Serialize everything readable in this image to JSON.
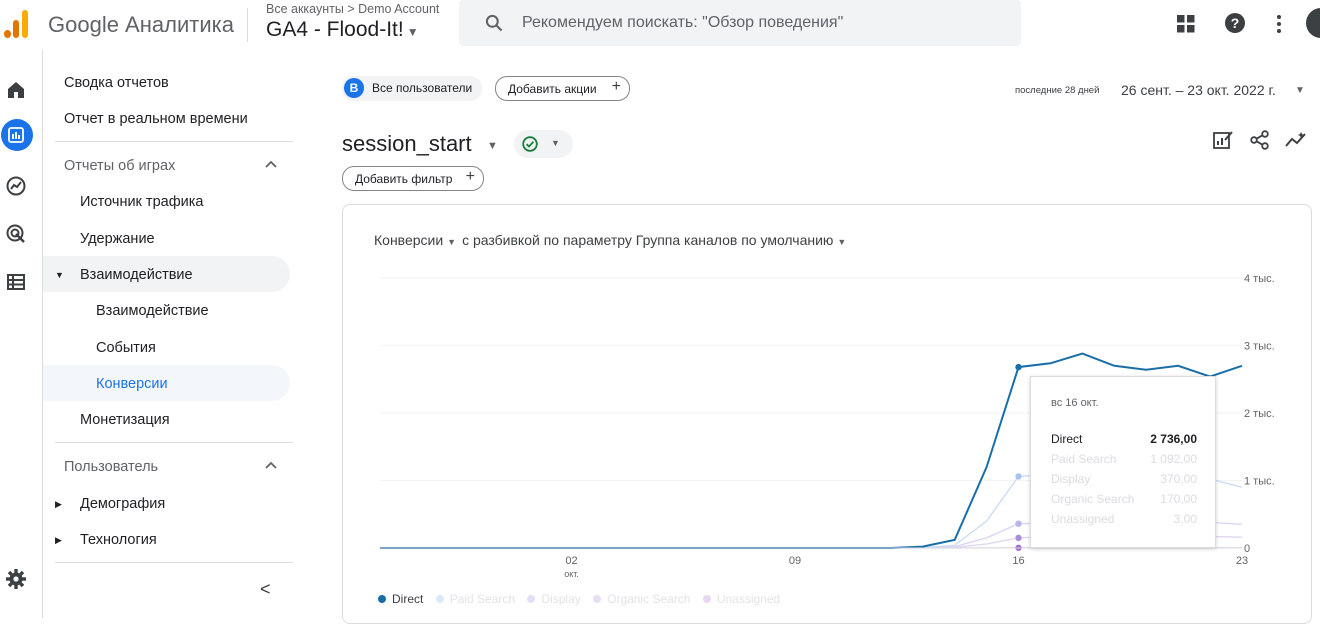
{
  "header": {
    "brand": "Google Аналитика",
    "breadcrumb": "Все аккаунты > Demo Account",
    "property": "GA4 - Flood-It!",
    "search_placeholder": "Рекомендуем поискать: \"Обзор поведения\"",
    "icons": [
      "apps-grid-icon",
      "help-icon",
      "more-vert-icon",
      "avatar"
    ]
  },
  "rail": {
    "icons": [
      "home-icon",
      "reports-icon",
      "explore-icon",
      "advertising-icon",
      "configure-icon",
      "settings-icon"
    ]
  },
  "nav": {
    "summary": "Сводка отчетов",
    "realtime": "Отчет в реальном времени",
    "games_section": "Отчеты об играх",
    "traffic": "Источник трафика",
    "retention": "Удержание",
    "engagement": "Взаимодействие",
    "engagement_overview": "Взаимодействие",
    "events": "События",
    "conversions": "Конверсии",
    "monetization": "Монетизация",
    "user_section": "Пользователь",
    "demographics": "Демография",
    "tech": "Технология",
    "collapse": "<"
  },
  "toolbar": {
    "segment_badge": "B",
    "segment_label": "Все пользователи",
    "add_comparison": "Добавить акции",
    "date_small": "последние 28 дней",
    "date_range": "26 сент. – 23 окт. 2022 г."
  },
  "report": {
    "title": "session_start",
    "add_filter": "Добавить фильтр"
  },
  "card": {
    "metric": "Конверсии",
    "breakdown": "с разбивкой по параметру Группа каналов по умолчанию"
  },
  "tooltip": {
    "date": "вс 16 окт.",
    "rows": [
      {
        "label": "Direct",
        "value": "2 736,00"
      },
      {
        "label": "Paid Search",
        "value": "1 092,00"
      },
      {
        "label": "Display",
        "value": "370,00"
      },
      {
        "label": "Organic Search",
        "value": "170,00"
      },
      {
        "label": "Unassigned",
        "value": "3,00"
      }
    ]
  },
  "colors": {
    "accent": "#1a73e8",
    "direct": "#1a6ea8",
    "paid_search": "#c9dcf3",
    "display": "#d6d4f4",
    "organic_search": "#e0d4f0",
    "unassigned": "#e0cff0"
  },
  "chart_data": {
    "type": "line",
    "x": [
      "26",
      "27",
      "28",
      "29",
      "30",
      "01",
      "02",
      "03",
      "04",
      "05",
      "06",
      "07",
      "08",
      "09",
      "10",
      "11",
      "12",
      "13",
      "14",
      "15",
      "16",
      "17",
      "18",
      "19",
      "20",
      "21",
      "22",
      "23"
    ],
    "x_ticks": [
      {
        "value": "02",
        "sub": "окт."
      },
      {
        "value": "09",
        "sub": ""
      },
      {
        "value": "16",
        "sub": ""
      },
      {
        "value": "23",
        "sub": ""
      }
    ],
    "y_ticks": [
      "0",
      "1 тыс.",
      "2 тыс.",
      "3 тыс.",
      "4 тыс."
    ],
    "ylim": [
      0,
      4000
    ],
    "legend": "bottom",
    "series": [
      {
        "name": "Direct",
        "values": [
          0,
          0,
          0,
          0,
          0,
          0,
          0,
          0,
          0,
          0,
          0,
          0,
          0,
          0,
          0,
          0,
          0,
          20,
          120,
          1200,
          2680,
          2736,
          2880,
          2700,
          2640,
          2700,
          2540,
          2700
        ]
      },
      {
        "name": "Paid Search",
        "values": [
          0,
          0,
          0,
          0,
          0,
          0,
          0,
          0,
          0,
          0,
          0,
          0,
          0,
          0,
          0,
          0,
          0,
          5,
          40,
          400,
          1060,
          1092,
          1180,
          1080,
          1050,
          1100,
          1020,
          900
        ]
      },
      {
        "name": "Display",
        "values": [
          0,
          0,
          0,
          0,
          0,
          0,
          0,
          0,
          0,
          0,
          0,
          0,
          0,
          0,
          0,
          0,
          0,
          2,
          20,
          150,
          360,
          370,
          430,
          380,
          360,
          400,
          380,
          350
        ]
      },
      {
        "name": "Organic Search",
        "values": [
          0,
          0,
          0,
          0,
          0,
          0,
          0,
          0,
          0,
          0,
          0,
          0,
          0,
          0,
          0,
          0,
          0,
          1,
          10,
          60,
          150,
          170,
          200,
          180,
          170,
          190,
          170,
          160
        ]
      },
      {
        "name": "Unassigned",
        "values": [
          0,
          0,
          0,
          0,
          0,
          0,
          0,
          0,
          0,
          0,
          0,
          0,
          0,
          0,
          0,
          0,
          0,
          0,
          0,
          1,
          3,
          3,
          4,
          3,
          3,
          3,
          3,
          3
        ]
      }
    ]
  }
}
